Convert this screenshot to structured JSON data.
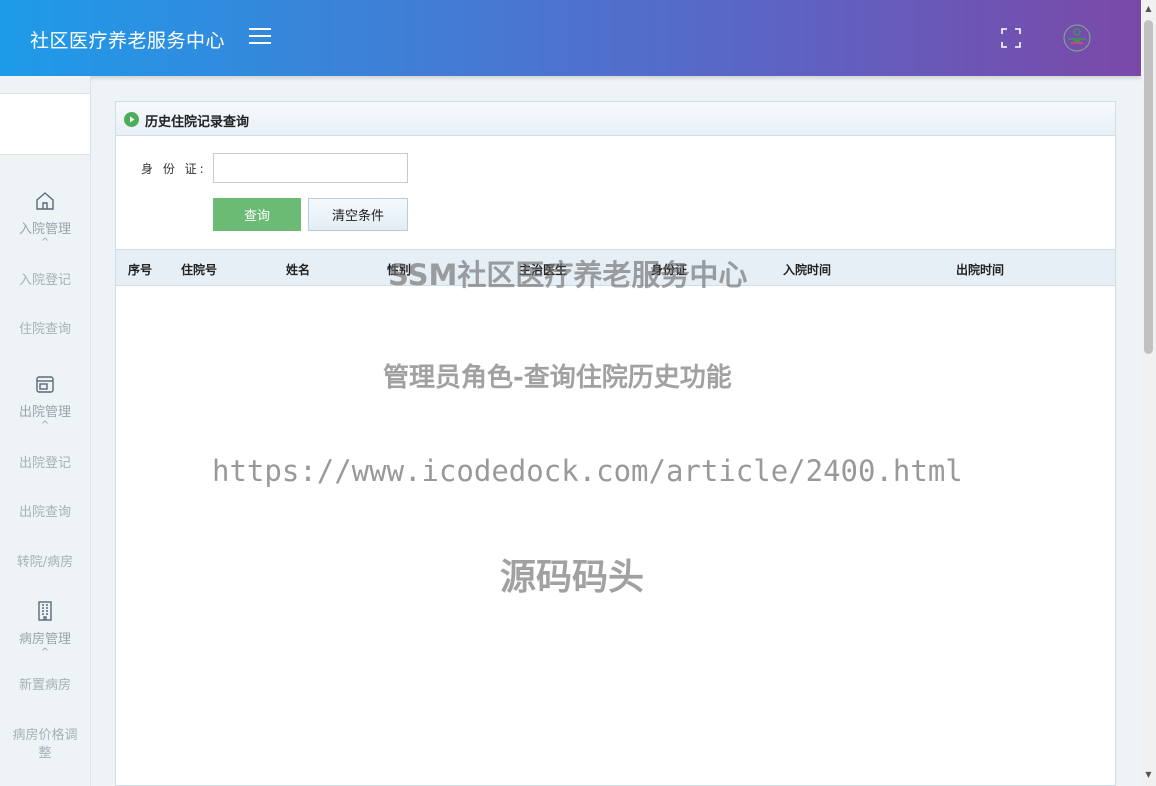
{
  "header": {
    "title": "社区医疗养老服务中心",
    "menu_icon": "hamburger-menu-icon",
    "fullscreen_icon": "fullscreen-icon",
    "avatar_icon": "user-avatar-icon"
  },
  "sidebar": {
    "groups": [
      {
        "label": "入院管理",
        "icon": "home-icon",
        "items": [
          "入院登记",
          "住院查询"
        ]
      },
      {
        "label": "出院管理",
        "icon": "window-icon",
        "items": [
          "出院登记",
          "出院查询",
          "转院/病房"
        ]
      },
      {
        "label": "病房管理",
        "icon": "building-icon",
        "items": [
          "新置病房",
          "病房价格调整"
        ]
      }
    ],
    "caret": "^"
  },
  "panel": {
    "title": "历史住院记录查询",
    "id_label": "身 份 证:",
    "id_value": "",
    "query_button": "查询",
    "clear_button": "清空条件"
  },
  "table": {
    "columns": [
      "序号",
      "住院号",
      "姓名",
      "性别",
      "主治医生",
      "身份证",
      "入院时间",
      "出院时间"
    ],
    "rows": []
  },
  "watermark": {
    "line1": "SSM社区医疗养老服务中心",
    "line2": "管理员角色-查询住院历史功能",
    "line3": "https://www.icodedock.com/article/2400.html",
    "line4": "源码码头"
  },
  "colors": {
    "header_start": "#1e9be8",
    "header_end": "#7a49a8",
    "query_button": "#6bbb74",
    "sidebar_text": "#9aa4ad"
  }
}
